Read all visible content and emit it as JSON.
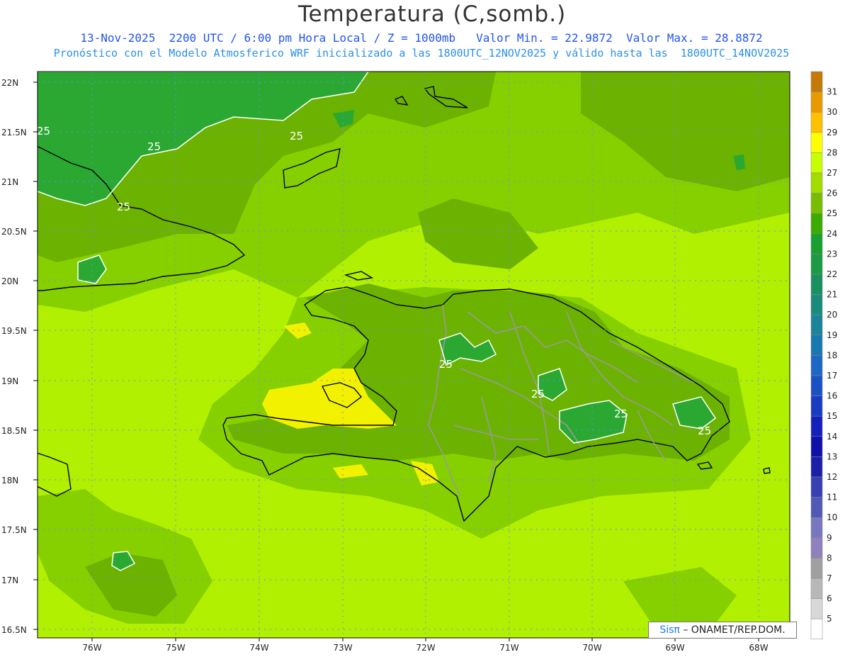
{
  "header": {
    "title": "Temperatura (C,somb.)",
    "line1": "13-Nov-2025  2200 UTC / 6:00 pm Hora Local / Z = 1000mb   Valor Min. = 22.9872  Valor Max. = 28.8872",
    "line2": "Pronóstico con el Modelo Atmosferico WRF inicializado a las 1800UTC_12NOV2025 y válido hasta las  1800UTC_14NOV2025"
  },
  "axes": {
    "lat_labels": [
      "22N",
      "21.5N",
      "21N",
      "20.5N",
      "20N",
      "19.5N",
      "19N",
      "18.5N",
      "18N",
      "17.5N",
      "17N",
      "16.5N"
    ],
    "lon_labels": [
      "76W",
      "75W",
      "74W",
      "73W",
      "72W",
      "71W",
      "70W",
      "69W",
      "68W"
    ]
  },
  "contour_label": "25",
  "colorbar": {
    "labels": [
      "31",
      "30",
      "29",
      "28",
      "27",
      "26",
      "25",
      "24",
      "23",
      "22",
      "21",
      "20",
      "19",
      "18",
      "17",
      "16",
      "15",
      "14",
      "13",
      "12",
      "11",
      "10",
      "9",
      "8",
      "7",
      "6",
      "5"
    ],
    "colors": [
      "#c47a06",
      "#e89a00",
      "#ffc000",
      "#ffff00",
      "#c8ff00",
      "#a2dc00",
      "#78be00",
      "#3cac00",
      "#1aa030",
      "#1c9a46",
      "#1a9060",
      "#1a8c7c",
      "#1a8498",
      "#1a78b0",
      "#1c68c4",
      "#1a52c4",
      "#1a3cc4",
      "#1420bc",
      "#1010aa",
      "#1c20a8",
      "#3840b4",
      "#5058b8",
      "#7878c0",
      "#9080bc",
      "#a0a0a0",
      "#b8b8b8",
      "#d8d8d8",
      "#ffffff"
    ]
  },
  "credit": {
    "brand": "Sisπ",
    "text": "– ONAMET/REP.DOM."
  },
  "colors": {
    "base_field": "#b0f000",
    "zone_25_26": "#86d000",
    "zone_26_27": "#6cb200",
    "zone_gt_27": "#2aa832",
    "hot_28": "#f2f200",
    "contour": "#ffffff",
    "coast": "#000000",
    "borders": "#9a9a9a",
    "grid": "#6c8cff"
  }
}
